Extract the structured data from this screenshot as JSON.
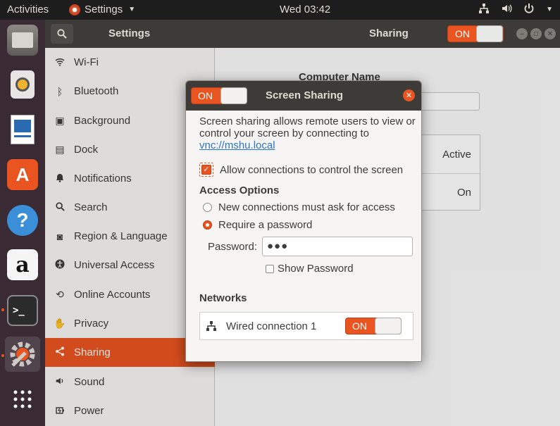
{
  "topbar": {
    "activities": "Activities",
    "app_name": "Settings",
    "clock": "Wed 03:42",
    "tray_icons": [
      "network-icon",
      "volume-icon",
      "power-icon"
    ]
  },
  "dock": {
    "items": [
      "files-icon",
      "rhythmbox-icon",
      "libreoffice-writer-icon",
      "software-center-icon",
      "help-icon",
      "amazon-icon",
      "terminal-icon",
      "settings-icon",
      "show-apps-icon"
    ]
  },
  "window": {
    "left_title": "Settings",
    "right_title": "Sharing",
    "header_switch": "ON"
  },
  "sidebar": {
    "items": [
      {
        "label": "Wi-Fi",
        "icon": "wifi-icon"
      },
      {
        "label": "Bluetooth",
        "icon": "bluetooth-icon"
      },
      {
        "label": "Background",
        "icon": "background-icon"
      },
      {
        "label": "Dock",
        "icon": "dock-icon"
      },
      {
        "label": "Notifications",
        "icon": "bell-icon"
      },
      {
        "label": "Search",
        "icon": "search-icon"
      },
      {
        "label": "Region & Language",
        "icon": "camera-icon"
      },
      {
        "label": "Universal Access",
        "icon": "accessibility-icon"
      },
      {
        "label": "Online Accounts",
        "icon": "accounts-icon"
      },
      {
        "label": "Privacy",
        "icon": "hand-icon"
      },
      {
        "label": "Sharing",
        "icon": "share-icon"
      },
      {
        "label": "Sound",
        "icon": "speaker-icon"
      },
      {
        "label": "Power",
        "icon": "power-icon"
      }
    ],
    "selected": "Sharing"
  },
  "main": {
    "computer_name_label": "Computer Name",
    "row1_status": "Active",
    "row2_status": "On"
  },
  "dialog": {
    "switch_label": "ON",
    "title": "Screen Sharing",
    "description_prefix": "Screen sharing allows remote users to view or control your screen by connecting to ",
    "description_link": "vnc://mshu.local",
    "allow_control_label": "Allow connections to control the screen",
    "allow_control_checked": true,
    "access_options_title": "Access Options",
    "radio_ask": "New connections must ask for access",
    "radio_password": "Require a password",
    "selected_radio": "Require a password",
    "password_label": "Password:",
    "password_value": "●●●",
    "show_password_label": "Show Password",
    "show_password_checked": false,
    "networks_title": "Networks",
    "network_name": "Wired connection 1",
    "network_switch": "ON"
  },
  "colors": {
    "accent": "#e95420",
    "header_bg": "#3c3b37",
    "dock_bg": "#3a2a33",
    "link": "#2a76c6"
  }
}
